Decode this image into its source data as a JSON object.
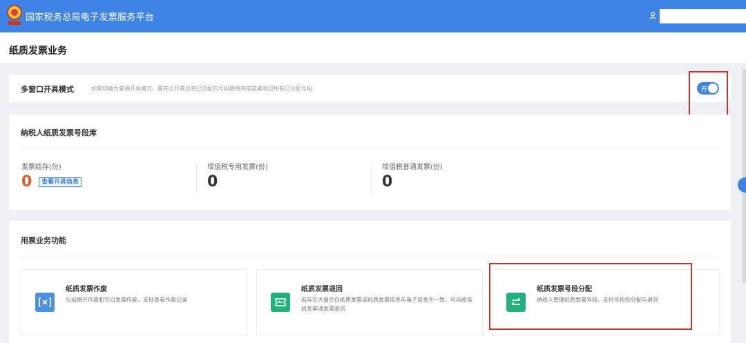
{
  "header": {
    "platform_title": "国家税务总局电子发票服务平台",
    "logo_icon": "tax-emblem-icon",
    "user_icon": "user-icon",
    "brand_color": "#3f83e6"
  },
  "page": {
    "title": "纸质发票业务"
  },
  "multi_window": {
    "title": "多窗口开具模式",
    "hint": "如需切换为普通开具模式，需先让开票员将已分配的号段使用完成或者收回所有已分配号段",
    "toggle": {
      "state": "on",
      "label": "开"
    }
  },
  "library": {
    "title": "纳税人纸质发票号段库",
    "stats": [
      {
        "label": "发票结存(份)",
        "value": "0",
        "link": "查看开具信息"
      },
      {
        "label": "增值税专用发票(份)",
        "value": "0"
      },
      {
        "label": "增值税普通发票(份)",
        "value": "0"
      }
    ]
  },
  "functions": {
    "title": "用票业务功能",
    "tiles": [
      {
        "name": "纸质发票作废",
        "desc": "包括填开作废和空白发票作废，支持查看作废记录",
        "icon": "void-invoice-icon",
        "color": "#4a8fe0"
      },
      {
        "name": "纸质发票退回",
        "desc": "若存在大量空白纸质发票或纸质发票信息与电子信息不一致，可向税务机关申请发票退回",
        "icon": "return-ticket-icon",
        "color": "#22b07d"
      },
      {
        "name": "纸质发票号段分配",
        "desc": "纳税人管理纸质发票号段，支持号段的分配与退回",
        "icon": "transfer-arrows-icon",
        "color": "#22b07d"
      }
    ]
  },
  "highlight_color": "#d0302b"
}
